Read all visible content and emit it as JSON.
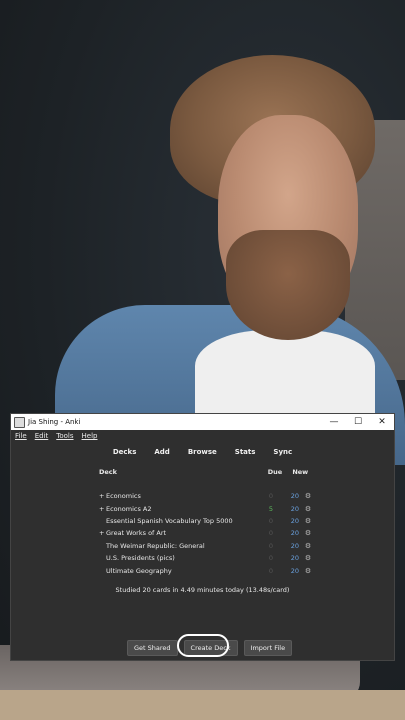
{
  "window": {
    "title": "Jia Shing - Anki",
    "controls": {
      "minimize": "—",
      "maximize": "☐",
      "close": "✕"
    }
  },
  "menu": [
    "File",
    "Edit",
    "Tools",
    "Help"
  ],
  "toolbar": [
    "Decks",
    "Add",
    "Browse",
    "Stats",
    "Sync"
  ],
  "deck_table": {
    "headers": {
      "deck": "Deck",
      "due": "Due",
      "new": "New"
    },
    "rows": [
      {
        "expander": "+",
        "name": "Economics",
        "due": "0",
        "new": "20"
      },
      {
        "expander": "+",
        "name": "Economics A2",
        "due": "5",
        "new": "20"
      },
      {
        "expander": "",
        "name": "Essential Spanish Vocabulary Top 5000",
        "due": "0",
        "new": "20"
      },
      {
        "expander": "+",
        "name": "Great Works of Art",
        "due": "0",
        "new": "20"
      },
      {
        "expander": "",
        "name": "The Weimar Republic: General",
        "due": "0",
        "new": "20"
      },
      {
        "expander": "",
        "name": "U.S. Presidents (pics)",
        "due": "0",
        "new": "20"
      },
      {
        "expander": "",
        "name": "Ultimate Geography",
        "due": "0",
        "new": "20"
      }
    ]
  },
  "studied_text": "Studied 20 cards in 4.49 minutes today (13.48s/card)",
  "buttons": {
    "get_shared": "Get Shared",
    "create_deck": "Create Deck",
    "import_file": "Import File"
  },
  "colors": {
    "due_active": "#5dbb5d",
    "new_count": "#6aa2e0",
    "window_bg": "#2f2f2f"
  }
}
